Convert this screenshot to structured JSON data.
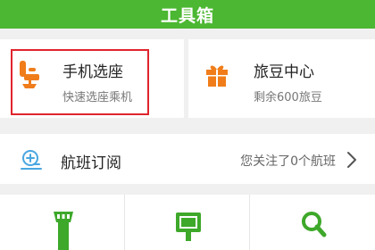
{
  "header": {
    "title": "工具箱"
  },
  "cards": [
    {
      "title": "手机选座",
      "subtitle": "快速选座乘机",
      "icon": "seat-icon"
    },
    {
      "title": "旅豆中心",
      "subtitle": "剩余600旅豆",
      "icon": "gift-icon"
    }
  ],
  "subscription": {
    "label": "航班订阅",
    "status": "您关注了0个航班",
    "icon": "plane-icon"
  },
  "bottom_icons": [
    "control-tower-icon",
    "monitor-icon",
    "search-icon"
  ],
  "colors": {
    "header_green": "#4cb732",
    "accent_orange": "#f07d1a",
    "highlight_red": "#e0242c",
    "icon_green": "#3ea82a",
    "icon_blue": "#4aa6e0"
  }
}
